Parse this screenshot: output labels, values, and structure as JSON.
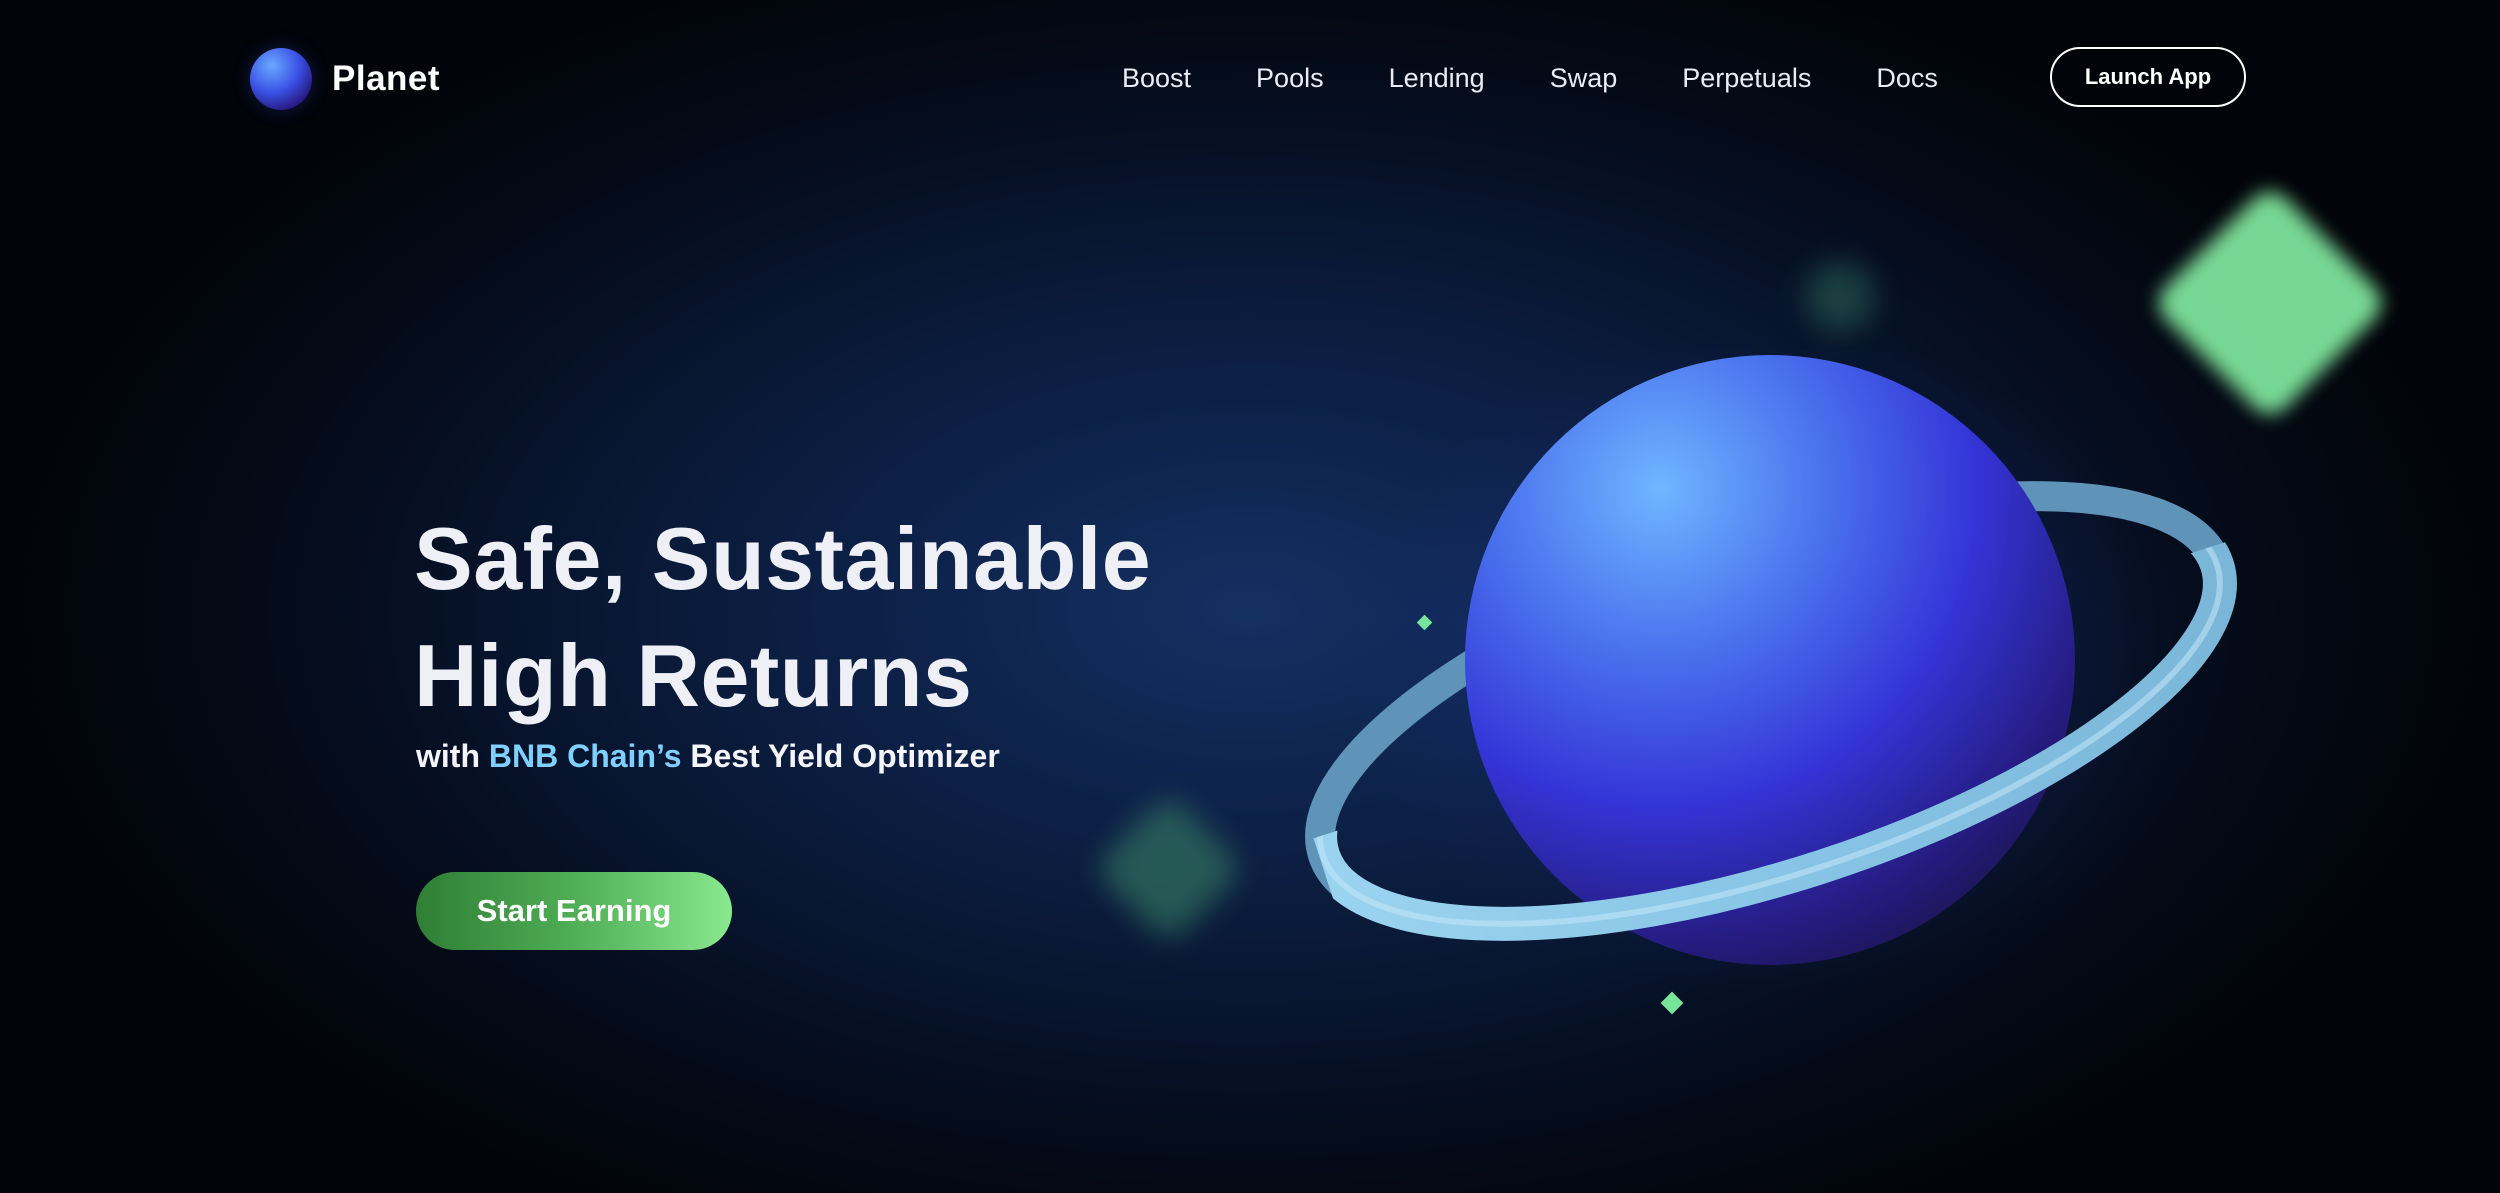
{
  "brand": {
    "name": "Planet",
    "logo_icon": "planet-ball-icon"
  },
  "nav": {
    "items": [
      {
        "label": "Boost"
      },
      {
        "label": "Pools"
      },
      {
        "label": "Lending"
      },
      {
        "label": "Swap"
      },
      {
        "label": "Perpetuals"
      },
      {
        "label": "Docs"
      }
    ],
    "launch_label": "Launch App"
  },
  "hero": {
    "title_line1": "Safe, Sustainable",
    "title_line2": "High Returns",
    "subtitle_prefix": "with ",
    "subtitle_accent": "BNB Chain’s",
    "subtitle_suffix": " Best Yield Optimizer",
    "cta_label": "Start Earning"
  },
  "illustration": {
    "planet_icon": "ringed-planet-icon",
    "decor_icons": [
      "green-diamond-icon",
      "sparkle-icon"
    ]
  },
  "colors": {
    "background": "#081631",
    "accent_blue": "#7fd0ff",
    "accent_green": "#7ee39b",
    "cta_start": "#2f7e34",
    "cta_end": "#8ae98e",
    "planet_blue": "#3a3ee0",
    "ring": "#8ec9ea"
  }
}
